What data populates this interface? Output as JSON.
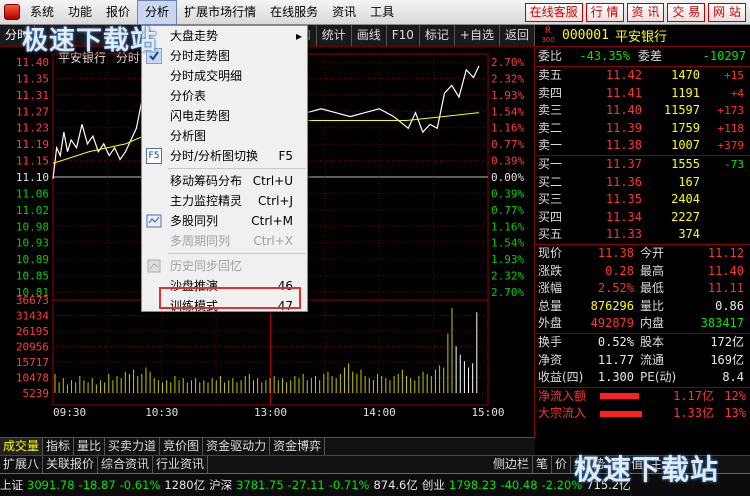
{
  "menubar": {
    "items": [
      "系统",
      "功能",
      "报价",
      "分析",
      "扩展市场行情",
      "在线服务",
      "资讯",
      "工具"
    ],
    "active": "分析",
    "buttons": [
      "在线客服",
      "行 情",
      "资 讯",
      "交 易",
      "网 站"
    ]
  },
  "toolbar": {
    "items": [
      "分时",
      "叠加",
      "统计",
      "画线",
      "F10",
      "标记",
      "+自选",
      "返回"
    ]
  },
  "chart_header": {
    "name": "平安银行",
    "mode": "分时"
  },
  "chart_data": {
    "type": "line",
    "price_axis": [
      "11.40",
      "11.35",
      "11.31",
      "11.27",
      "11.23",
      "11.19",
      "11.15",
      "11.10",
      "11.06",
      "11.02",
      "10.98",
      "10.93",
      "10.89",
      "10.85",
      "10.81"
    ],
    "pct_axis": [
      "2.70%",
      "2.32%",
      "1.93%",
      "1.54%",
      "1.16%",
      "0.77%",
      "0.39%",
      "0.00%",
      "0.39%",
      "0.77%",
      "1.16%",
      "1.54%",
      "1.93%",
      "2.32%",
      "2.70%"
    ],
    "volume_axis": [
      "36673",
      "31434",
      "26195",
      "20956",
      "15717",
      "10478",
      "5239"
    ],
    "time_axis": [
      "09:30",
      "10:30",
      "13:00",
      "14:00",
      "15:00"
    ],
    "ylim": [
      10.81,
      11.4
    ],
    "base_price": 11.1,
    "price_series": [
      [
        0,
        11.1
      ],
      [
        2,
        11.18
      ],
      [
        4,
        11.16
      ],
      [
        6,
        11.22
      ],
      [
        8,
        11.17
      ],
      [
        10,
        11.2
      ],
      [
        13,
        11.18
      ],
      [
        16,
        11.24
      ],
      [
        19,
        11.19
      ],
      [
        22,
        11.21
      ],
      [
        25,
        11.17
      ],
      [
        28,
        11.19
      ],
      [
        31,
        11.16
      ],
      [
        34,
        11.18
      ],
      [
        37,
        11.15
      ],
      [
        40,
        11.17
      ],
      [
        43,
        11.2
      ],
      [
        46,
        11.23
      ],
      [
        49,
        11.3
      ],
      [
        52,
        11.34
      ],
      [
        55,
        11.33
      ],
      [
        58,
        11.35
      ],
      [
        61,
        11.32
      ],
      [
        64,
        11.36
      ],
      [
        67,
        11.33
      ],
      [
        70,
        11.3
      ],
      [
        74,
        11.27
      ],
      [
        80,
        11.26
      ],
      [
        86,
        11.28
      ],
      [
        92,
        11.27
      ],
      [
        100,
        11.29
      ],
      [
        108,
        11.27
      ],
      [
        116,
        11.28
      ],
      [
        124,
        11.27
      ],
      [
        132,
        11.26
      ],
      [
        140,
        11.27
      ],
      [
        148,
        11.28
      ],
      [
        156,
        11.27
      ],
      [
        164,
        11.26
      ],
      [
        172,
        11.27
      ],
      [
        180,
        11.28
      ],
      [
        188,
        11.26
      ],
      [
        196,
        11.23
      ],
      [
        200,
        11.27
      ],
      [
        204,
        11.22
      ],
      [
        208,
        11.24
      ],
      [
        212,
        11.23
      ],
      [
        216,
        11.32
      ],
      [
        220,
        11.34
      ],
      [
        224,
        11.31
      ],
      [
        228,
        11.38
      ],
      [
        232,
        11.36
      ],
      [
        235,
        11.39
      ]
    ],
    "avg_series": [
      [
        0,
        11.14
      ],
      [
        20,
        11.17
      ],
      [
        40,
        11.19
      ],
      [
        60,
        11.23
      ],
      [
        80,
        11.24
      ],
      [
        110,
        11.25
      ],
      [
        140,
        11.25
      ],
      [
        170,
        11.25
      ],
      [
        195,
        11.25
      ],
      [
        215,
        11.26
      ],
      [
        235,
        11.27
      ]
    ],
    "volume": [
      9,
      5,
      7,
      4,
      6,
      5,
      8,
      6,
      5,
      7,
      4,
      6,
      5,
      9,
      6,
      8,
      7,
      10,
      9,
      11,
      8,
      9,
      12,
      10,
      7,
      6,
      5,
      6,
      5,
      8,
      6,
      7,
      5,
      6,
      7,
      5,
      6,
      5,
      7,
      6,
      8,
      5,
      6,
      7,
      5,
      6,
      8,
      9,
      6,
      7,
      5,
      6,
      7,
      8,
      6,
      7,
      5,
      6,
      8,
      7,
      9,
      6,
      7,
      8,
      6,
      9,
      10,
      8,
      7,
      9,
      12,
      14,
      10,
      9,
      11,
      8,
      7,
      6,
      9,
      8,
      7,
      6,
      8,
      9,
      11,
      8,
      7,
      6,
      8,
      10,
      9,
      8,
      11,
      13,
      12,
      28,
      40,
      22,
      18,
      15,
      12,
      14,
      38
    ],
    "volume_max": 41912
  },
  "quote": {
    "header": {
      "code": "000001",
      "name": "平安银行",
      "market": "R",
      "market_sub": "300"
    },
    "weibi": {
      "label": "委比",
      "value": "-43.35%",
      "label2": "委差",
      "value2": "-10297"
    },
    "asks": [
      {
        "label": "卖五",
        "price": "11.42",
        "vol": "1470",
        "chg": "+15"
      },
      {
        "label": "卖四",
        "price": "11.41",
        "vol": "1191",
        "chg": "+4"
      },
      {
        "label": "卖三",
        "price": "11.40",
        "vol": "11597",
        "chg": "+173"
      },
      {
        "label": "卖二",
        "price": "11.39",
        "vol": "1759",
        "chg": "+118"
      },
      {
        "label": "卖一",
        "price": "11.38",
        "vol": "1007",
        "chg": "+379"
      }
    ],
    "bids": [
      {
        "label": "买一",
        "price": "11.37",
        "vol": "1555",
        "chg": "-73"
      },
      {
        "label": "买二",
        "price": "11.36",
        "vol": "167",
        "chg": ""
      },
      {
        "label": "买三",
        "price": "11.35",
        "vol": "2404",
        "chg": ""
      },
      {
        "label": "买四",
        "price": "11.34",
        "vol": "2227",
        "chg": ""
      },
      {
        "label": "买五",
        "price": "11.33",
        "vol": "374",
        "chg": ""
      }
    ],
    "stats": [
      {
        "l1": "现价",
        "v1": "11.38",
        "l2": "今开",
        "v2": "11.12",
        "c1": "red",
        "c2": "red"
      },
      {
        "l1": "涨跌",
        "v1": "0.28",
        "l2": "最高",
        "v2": "11.40",
        "c1": "red",
        "c2": "red"
      },
      {
        "l1": "涨幅",
        "v1": "2.52%",
        "l2": "最低",
        "v2": "11.11",
        "c1": "red",
        "c2": "red"
      },
      {
        "l1": "总量",
        "v1": "876296",
        "l2": "量比",
        "v2": "0.86",
        "c1": "yel",
        "c2": "wht"
      },
      {
        "l1": "外盘",
        "v1": "492879",
        "l2": "内盘",
        "v2": "383417",
        "c1": "red",
        "c2": "green"
      }
    ],
    "stats2": [
      {
        "l1": "换手",
        "v1": "0.52%",
        "l2": "股本",
        "v2": "172亿"
      },
      {
        "l1": "净资",
        "v1": "11.77",
        "l2": "流通",
        "v2": "169亿"
      },
      {
        "l1": "收益(四)",
        "v1": "1.300",
        "l2": "PE(动)",
        "v2": "8.4"
      }
    ],
    "flows": [
      {
        "label": "净流入额",
        "value": "1.17亿",
        "pct": "12%",
        "bar": 0.55
      },
      {
        "label": "大宗流入",
        "value": "1.33亿",
        "pct": "13%",
        "bar": 0.6
      }
    ]
  },
  "tabs_row1": [
    "成交量",
    "指标",
    "量比",
    "买卖力道",
    "竞价图",
    "资金驱动力",
    "资金博弈"
  ],
  "tabs_row2": [
    "扩展八",
    "关联报价",
    "综合资讯",
    "行业资讯"
  ],
  "right_tabs": [
    "侧边栏",
    "笔",
    "价",
    "细",
    "势",
    "联",
    "值",
    "主",
    "筹"
  ],
  "status": {
    "sh_label": "上证",
    "sh_val": "3091.78",
    "sh_chg": "-18.87",
    "sh_pct": "-0.61%",
    "sh_amt": "1280亿",
    "hs_label": "沪深",
    "hs_val": "3781.75",
    "hs_chg": "-27.11",
    "hs_pct": "-0.71%",
    "hs_amt": "874.6亿",
    "cy_label": "创业",
    "cy_val": "1798.23",
    "cy_chg": "-40.48",
    "cy_pct": "-2.20%",
    "cy_amt": "715.2亿"
  },
  "dropdown": {
    "items": [
      {
        "label": "大盘走势",
        "key": "",
        "icon": "",
        "submenu": true
      },
      {
        "label": "分时走势图",
        "key": "",
        "icon": "check-icon"
      },
      {
        "label": "分时成交明细",
        "key": "",
        "icon": ""
      },
      {
        "label": "分价表",
        "key": "",
        "icon": ""
      },
      {
        "label": "闪电走势图",
        "key": "",
        "icon": ""
      },
      {
        "label": "分析图",
        "key": "",
        "icon": ""
      },
      {
        "label": "分时/分析图切换",
        "key": "F5",
        "icon": "f5-icon"
      },
      {
        "divider": true
      },
      {
        "label": "移动筹码分布",
        "key": "Ctrl+U",
        "icon": ""
      },
      {
        "label": "主力监控精灵",
        "key": "Ctrl+J",
        "icon": ""
      },
      {
        "label": "多股同列",
        "key": "Ctrl+M",
        "icon": "multi-chart-icon"
      },
      {
        "label": "多周期同列",
        "key": "Ctrl+X",
        "icon": "",
        "disabled": true
      },
      {
        "divider": true
      },
      {
        "label": "历史同步回忆",
        "key": "",
        "icon": "history-icon",
        "disabled": true
      },
      {
        "label": "沙盘推演",
        "key": "46",
        "icon": ""
      },
      {
        "label": "训练模式",
        "key": "47",
        "icon": "",
        "highlight": true
      }
    ]
  },
  "watermark": "极速下载站"
}
